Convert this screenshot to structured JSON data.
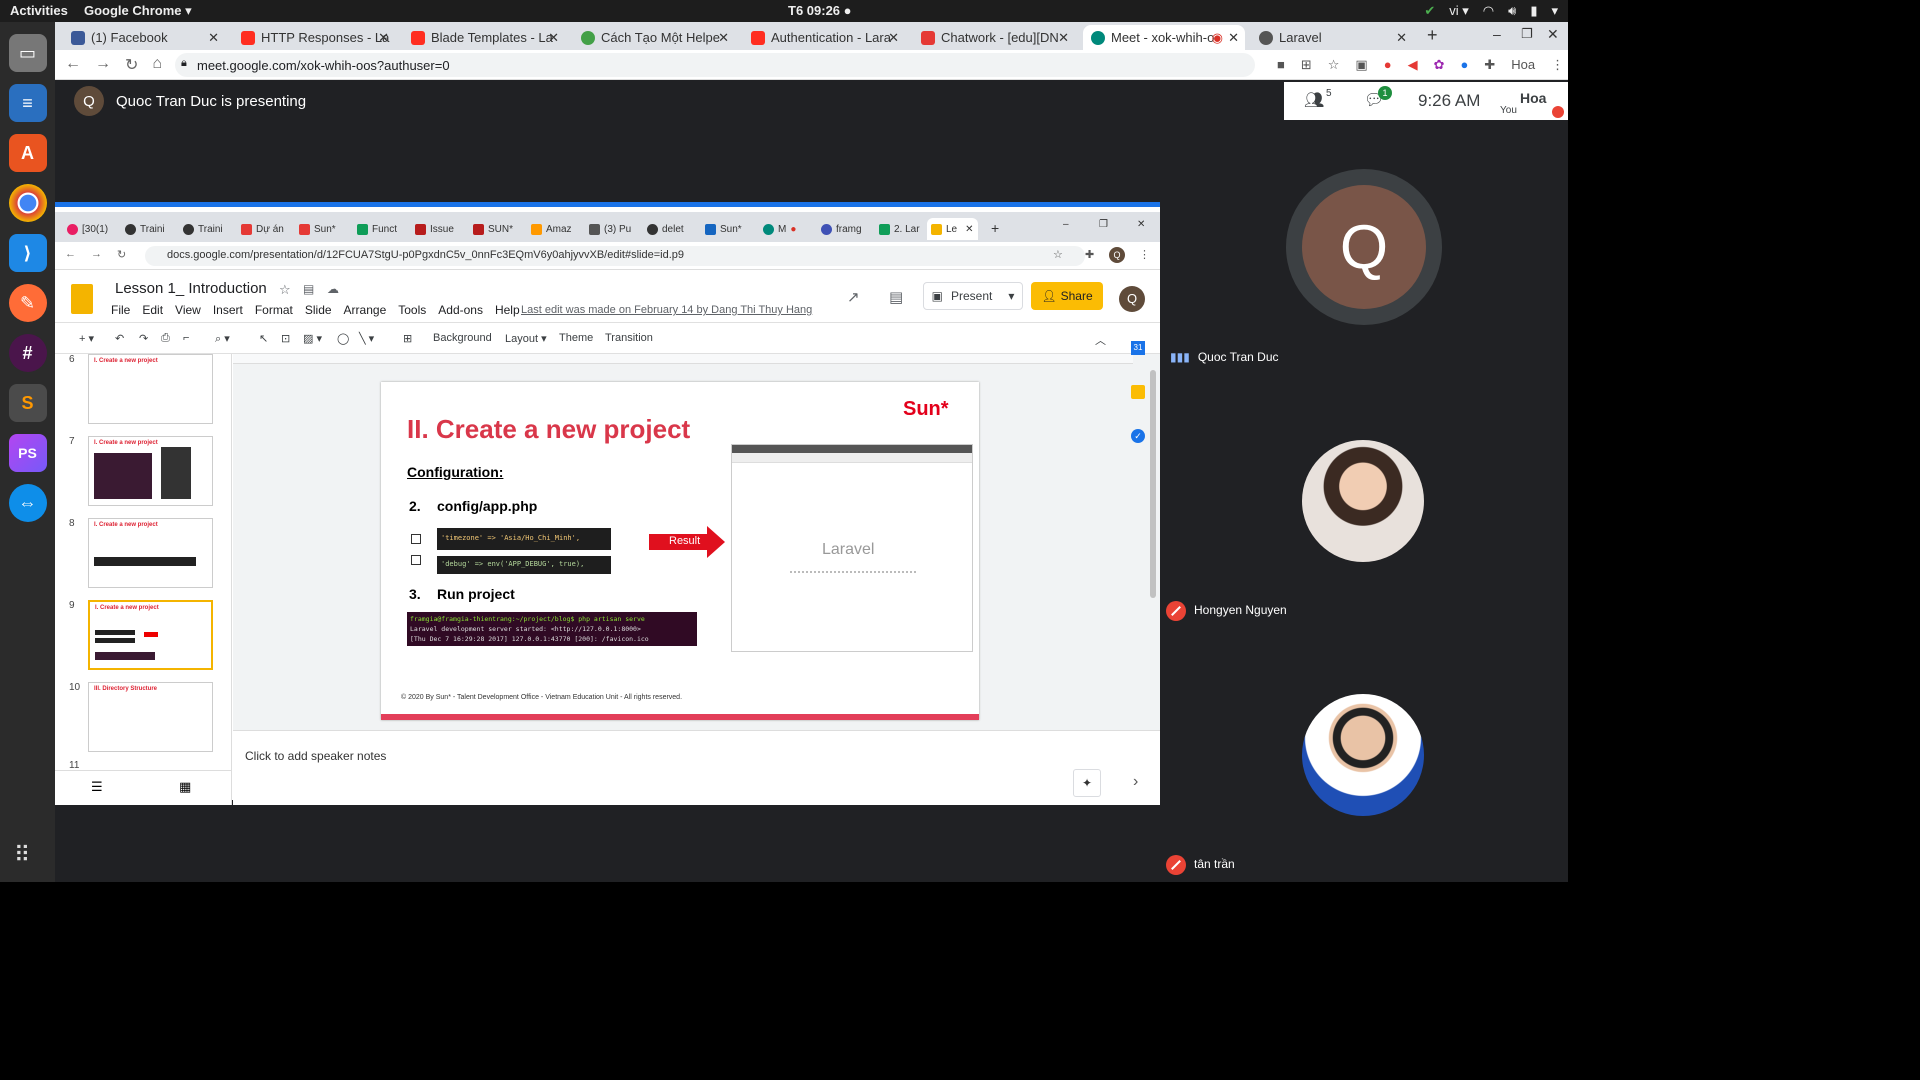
{
  "topbar": {
    "activities": "Activities",
    "app": "Google Chrome ▾",
    "clock": "T6 09:26 ●",
    "lang": "vi ▾"
  },
  "browser": {
    "tabs": [
      {
        "label": "(1) Facebook",
        "color": "#3b5998"
      },
      {
        "label": "HTTP Responses - La",
        "color": "#ff2d20"
      },
      {
        "label": "Blade Templates - La",
        "color": "#ff2d20"
      },
      {
        "label": "Cách Tạo Một Helpe",
        "color": "#43a047"
      },
      {
        "label": "Authentication - Lara",
        "color": "#ff2d20"
      },
      {
        "label": "Chatwork - [edu][DN",
        "color": "#e53935"
      },
      {
        "label": "Meet - xok-whih-o",
        "color": "#00897b"
      },
      {
        "label": "Laravel",
        "color": "#555"
      }
    ],
    "url": "meet.google.com/xok-whih-oos?authuser=0"
  },
  "meet": {
    "presenter_initial": "Q",
    "presenting_text": "Quoc Tran Duc is presenting",
    "people_count": "5",
    "chat_badge": "1",
    "time": "9:26 AM",
    "you_label": "You",
    "you_name": "Hoa",
    "participants": [
      {
        "name": "Quoc Tran Duc",
        "initial": "Q"
      },
      {
        "name": "Hongyen Nguyen"
      },
      {
        "name": "tân trần"
      }
    ]
  },
  "shared": {
    "inner_tabs": [
      "[30(1)",
      "Traini",
      "Traini",
      "Dự án",
      "Sun*",
      "Funct",
      "Issue",
      "SUN*",
      "Amaz",
      "(3) Pu",
      "delet",
      "Sun*",
      "M",
      "framg",
      "2. Lar",
      "Le"
    ],
    "url": "docs.google.com/presentation/d/12FCUA7StgU-p0PgxdnC5v_0nnFc3EQmV6y0ahjyvvXB/edit#slide=id.p9",
    "doc_title": "Lesson 1_ Introduction",
    "menus": [
      "File",
      "Edit",
      "View",
      "Insert",
      "Format",
      "Slide",
      "Arrange",
      "Tools",
      "Add-ons",
      "Help"
    ],
    "last_edit": "Last edit was made on February 14 by Dang Thi Thuy Hang",
    "present_label": "Present",
    "share_label": "Share",
    "user_initial": "Q",
    "toolbar": {
      "background": "Background",
      "layout": "Layout ▾",
      "theme": "Theme",
      "transition": "Transition"
    },
    "thumbs": [
      {
        "num": "6",
        "title": "I. Create a new project"
      },
      {
        "num": "7",
        "title": "I. Create a new project"
      },
      {
        "num": "8",
        "title": "I. Create a new project"
      },
      {
        "num": "9",
        "title": "I. Create a new project"
      },
      {
        "num": "10",
        "title": "III. Directory Structure"
      },
      {
        "num": "11",
        "title": ""
      }
    ],
    "notes": "Click to add speaker notes"
  },
  "slide": {
    "title": "II. Create a new project",
    "brand": "Sun*",
    "config_label": "Configuration:",
    "step2_num": "2.",
    "step2": "config/app.php",
    "code1": "'timezone' => 'Asia/Ho_Chi_Minh',",
    "code2": "'debug' => env('APP_DEBUG', true),",
    "result": "Result",
    "step3_num": "3.",
    "step3": "Run project",
    "term1": "framgia@framgia-thientrang:~/project/blog$ php artisan serve",
    "term2": "Laravel development server started: <http://127.0.0.1:8000>",
    "term3": "[Thu Dec  7 16:29:28 2017] 127.0.0.1:43770 [200]: /favicon.ico",
    "laravel": "Laravel",
    "footer": "© 2020 By Sun* - Talent Development Office - Vietnam Education Unit - All rights reserved."
  },
  "colors": {
    "slide_red": "#d9374a",
    "share_yellow": "#fbbc04",
    "meet_bg": "#202124"
  }
}
